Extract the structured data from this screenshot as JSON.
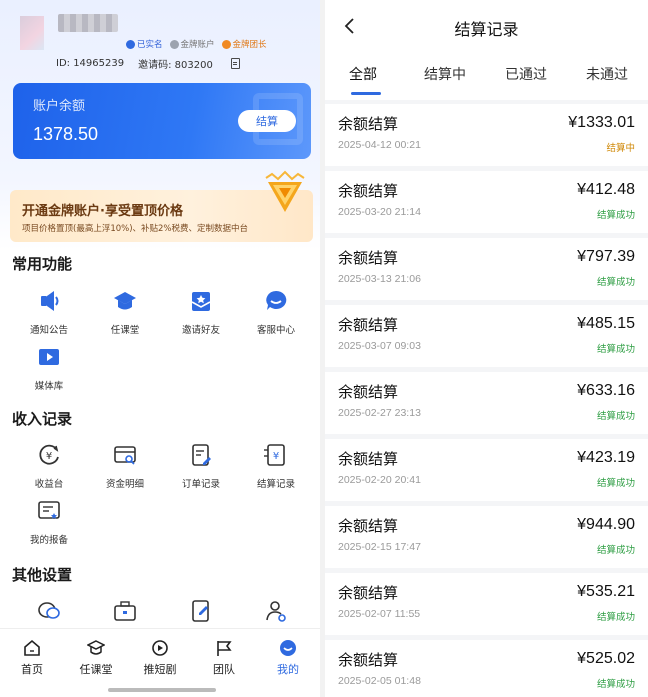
{
  "profile": {
    "tag_verified": "已实名",
    "tag_gold": "金牌账户",
    "tag_leader": "金牌团长",
    "id_text": "ID: 14965239",
    "invite_text": "邀请码: 803200"
  },
  "balance": {
    "label": "账户余额",
    "value": "1378.50",
    "settle_label": "结算"
  },
  "gold_banner": {
    "title": "开通金牌账户·享受置顶价格",
    "subtitle": "项目价格置顶(最高上浮10%)、补贴2%税费、定制数据中台"
  },
  "sections": {
    "common": {
      "title": "常用功能",
      "items": [
        "通知公告",
        "任课堂",
        "邀请好友",
        "客服中心",
        "媒体库"
      ]
    },
    "income": {
      "title": "收入记录",
      "items": [
        "收益台",
        "资金明细",
        "订单记录",
        "结算记录",
        "我的报备"
      ]
    },
    "other": {
      "title": "其他设置"
    }
  },
  "bottom_nav": [
    "首页",
    "任课堂",
    "推短剧",
    "团队",
    "我的"
  ],
  "colors": {
    "primary": "#2f6ae0",
    "success": "#2f9e44",
    "pending": "#d08a0a"
  },
  "settlement": {
    "title": "结算记录",
    "tabs": [
      "全部",
      "结算中",
      "已通过",
      "未通过"
    ],
    "records": [
      {
        "name": "余额结算",
        "date": "2025-04-12 00:21",
        "amount": "¥1333.01",
        "status": "结算中",
        "state": "pending"
      },
      {
        "name": "余额结算",
        "date": "2025-03-20 21:14",
        "amount": "¥412.48",
        "status": "结算成功",
        "state": "ok"
      },
      {
        "name": "余额结算",
        "date": "2025-03-13 21:06",
        "amount": "¥797.39",
        "status": "结算成功",
        "state": "ok"
      },
      {
        "name": "余额结算",
        "date": "2025-03-07 09:03",
        "amount": "¥485.15",
        "status": "结算成功",
        "state": "ok"
      },
      {
        "name": "余额结算",
        "date": "2025-02-27 23:13",
        "amount": "¥633.16",
        "status": "结算成功",
        "state": "ok"
      },
      {
        "name": "余额结算",
        "date": "2025-02-20 20:41",
        "amount": "¥423.19",
        "status": "结算成功",
        "state": "ok"
      },
      {
        "name": "余额结算",
        "date": "2025-02-15 17:47",
        "amount": "¥944.90",
        "status": "结算成功",
        "state": "ok"
      },
      {
        "name": "余额结算",
        "date": "2025-02-07 11:55",
        "amount": "¥535.21",
        "status": "结算成功",
        "state": "ok"
      },
      {
        "name": "余额结算",
        "date": "2025-02-05 01:48",
        "amount": "¥525.02",
        "status": "结算成功",
        "state": "ok"
      }
    ]
  }
}
